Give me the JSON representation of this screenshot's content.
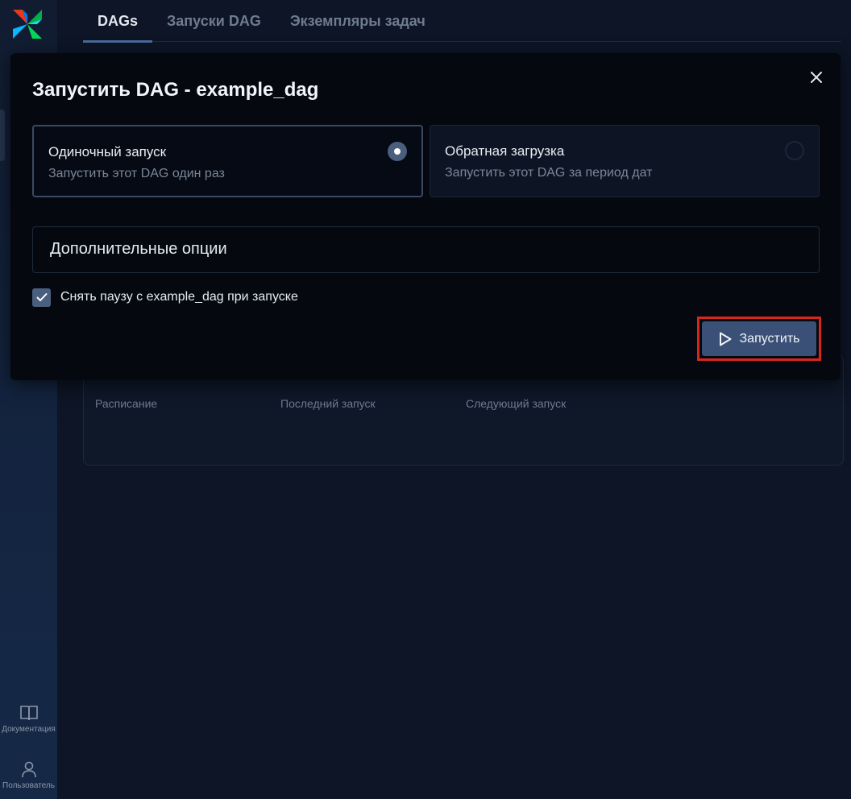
{
  "sidebar": {
    "logo_icon": "airflow-pinwheel-logo",
    "docs_label": "Документация",
    "user_label": "Пользователь"
  },
  "tabs": [
    {
      "label": "DAGs",
      "active": true
    },
    {
      "label": "Запуски DAG",
      "active": false
    },
    {
      "label": "Экземпляры задач",
      "active": false
    }
  ],
  "info_card": {
    "schedule_label": "Расписание",
    "last_run_label": "Последний запуск",
    "next_run_label": "Следующий запуск"
  },
  "modal": {
    "title": "Запустить DAG - example_dag",
    "close_icon": "close-icon",
    "options": [
      {
        "title": "Одиночный запуск",
        "subtitle": "Запустить этот DAG один раз",
        "selected": true
      },
      {
        "title": "Обратная загрузка",
        "subtitle": "Запустить этот DAG за период дат",
        "selected": false
      }
    ],
    "advanced_label": "Дополнительные опции",
    "unpause_checkbox": {
      "label": "Снять паузу с example_dag при запуске",
      "checked": true
    },
    "run_button_label": "Запустить",
    "highlight_color": "#d9261c",
    "accent_color": "#4a5e7d"
  }
}
